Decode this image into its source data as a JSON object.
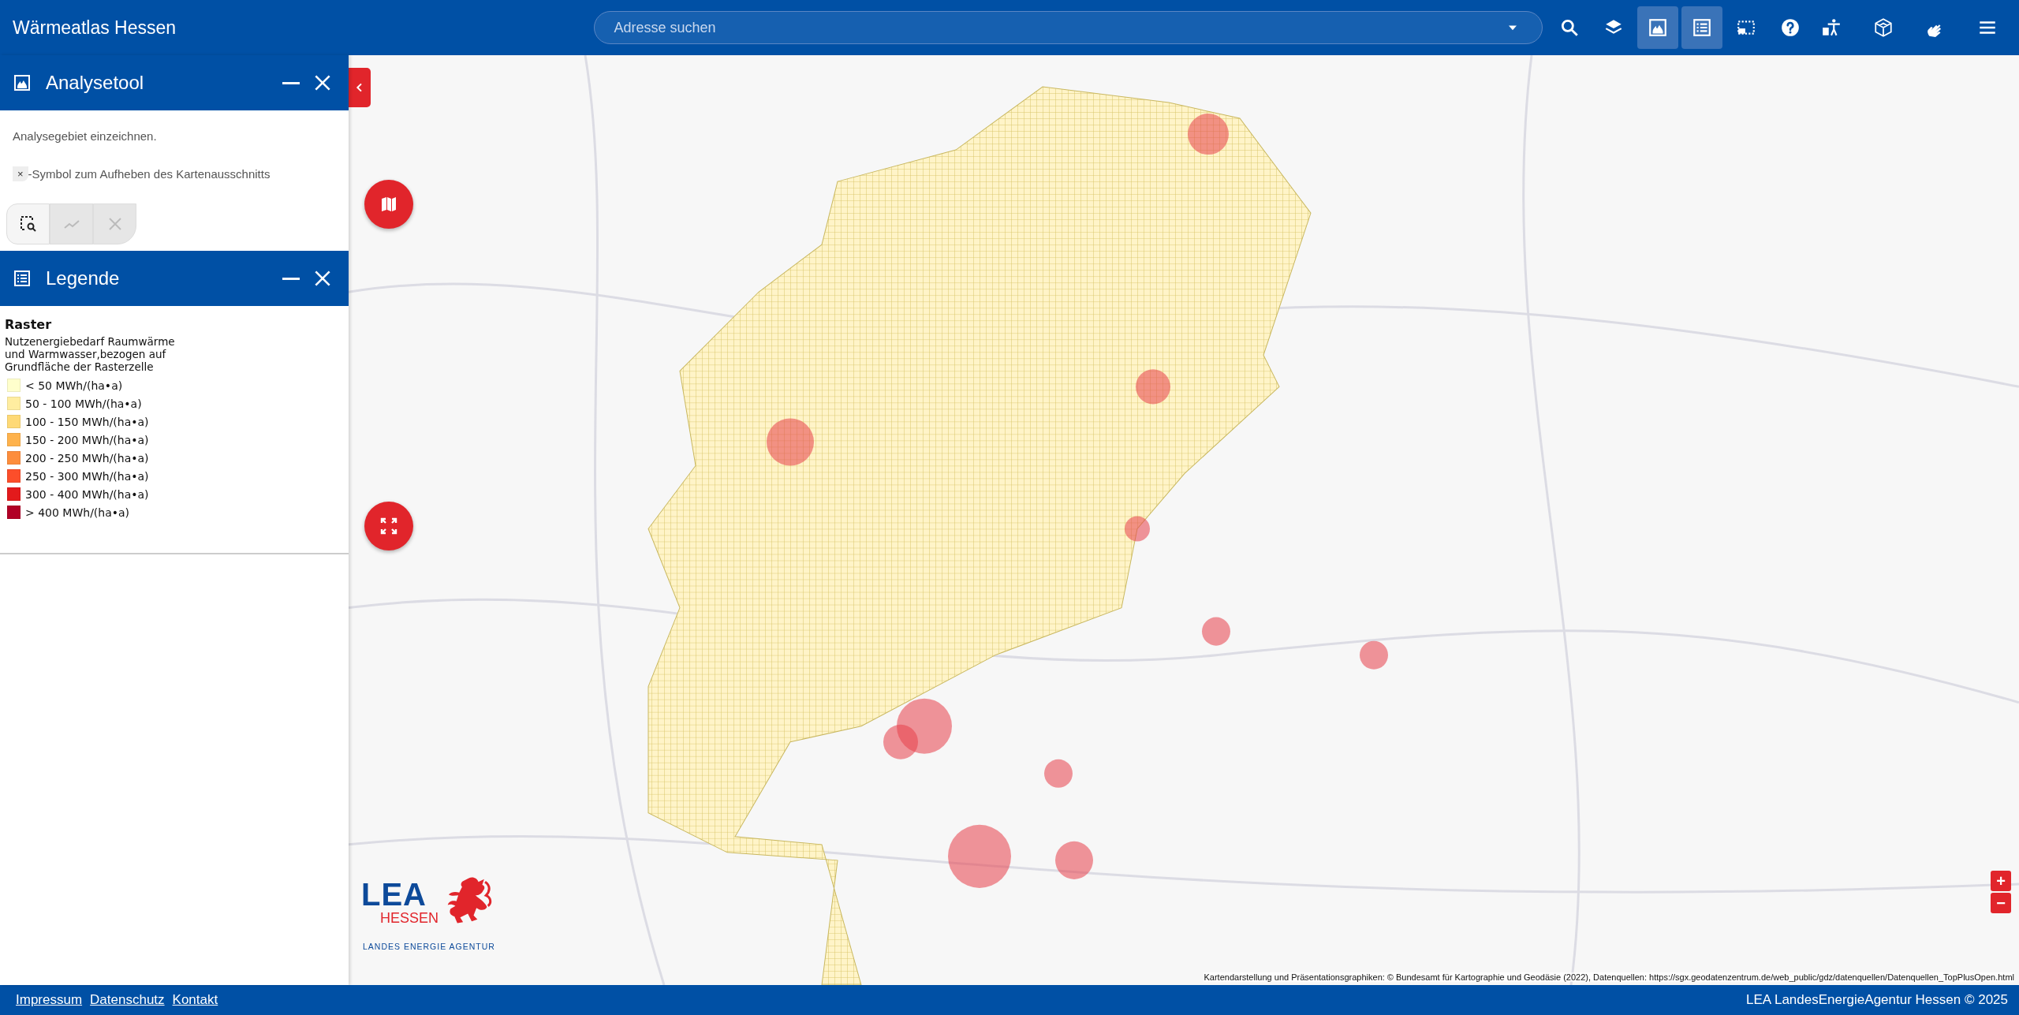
{
  "header": {
    "title": "Wärmeatlas Hessen",
    "search": {
      "placeholder": "Adresse suchen"
    },
    "tools": [
      {
        "kind": "search",
        "selected": false
      },
      {
        "kind": "layers",
        "selected": false
      },
      {
        "kind": "analysis",
        "selected": true
      },
      {
        "kind": "legend",
        "selected": true
      },
      {
        "kind": "selection",
        "selected": false
      },
      {
        "kind": "help",
        "selected": false
      }
    ],
    "extra_tools": [
      {
        "kind": "accessibility"
      },
      {
        "kind": "cube"
      },
      {
        "kind": "sign-language"
      },
      {
        "kind": "menu"
      }
    ]
  },
  "analysis_panel": {
    "title": "Analysetool",
    "instruction": "Analysegebiet einzeichnen.",
    "hint_symbol": "×",
    "hint": "-Symbol zum Aufheben des Kartenausschnitts",
    "draw_buttons": [
      {
        "kind": "rect-search",
        "disabled": false
      },
      {
        "kind": "line",
        "disabled": true
      },
      {
        "kind": "clear",
        "disabled": true
      }
    ]
  },
  "legend_panel": {
    "title": "Legende",
    "layer_title": "Raster",
    "description": "Nutzenergiebedarf Raumwärme und Warmwasser,bezogen auf Grundfläche der Rasterzelle",
    "items": [
      {
        "label": "< 50 MWh/(ha•a)",
        "color": "#ffffcc"
      },
      {
        "label": "50 - 100 MWh/(ha•a)",
        "color": "#ffeda0"
      },
      {
        "label": "100 - 150 MWh/(ha•a)",
        "color": "#fed976"
      },
      {
        "label": "150 - 200 MWh/(ha•a)",
        "color": "#feb24c"
      },
      {
        "label": "200 - 250 MWh/(ha•a)",
        "color": "#fd8d3c"
      },
      {
        "label": "250 - 300 MWh/(ha•a)",
        "color": "#fc4e2a"
      },
      {
        "label": "300 - 400 MWh/(ha•a)",
        "color": "#e31a1c"
      },
      {
        "label": "> 400 MWh/(ha•a)",
        "color": "#b10026"
      }
    ]
  },
  "map": {
    "logo": {
      "name": "LEA",
      "region": "HESSEN",
      "subtitle": "LANDES ENERGIE AGENTUR"
    },
    "zoom": [
      "+",
      "−"
    ],
    "attribution": "Kartendarstellung und Präsentationsgraphiken: © Bundesamt für Kartographie und Geodäsie (2022), Datenquellen: https://sgx.geodatenzentrum.de/web_public/gdz/datenquellen/Datenquellen_TopPlusOpen.html"
  },
  "footer": {
    "links": [
      "Impressum",
      "Datenschutz",
      "Kontakt"
    ],
    "copyright": "LEA LandesEnergieAgentur Hessen © 2025"
  }
}
